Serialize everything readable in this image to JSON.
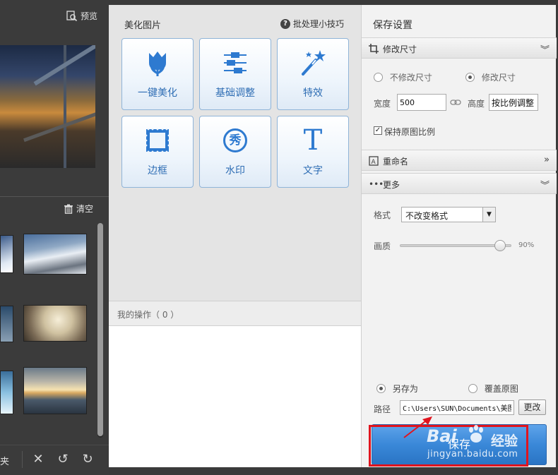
{
  "left_panel": {
    "preview_label": "预览",
    "clear_label": "清空",
    "folder_label": "夹"
  },
  "middle_panel": {
    "title": "美化图片",
    "tips_link": "批处理小技巧",
    "tiles": [
      {
        "label": "一键美化",
        "icon": "tulip-icon"
      },
      {
        "label": "基础调整",
        "icon": "sliders-icon"
      },
      {
        "label": "特效",
        "icon": "magic-wand-icon"
      },
      {
        "label": "边框",
        "icon": "frame-icon"
      },
      {
        "label": "水印",
        "icon": "watermark-icon"
      },
      {
        "label": "文字",
        "icon": "text-icon"
      }
    ],
    "watermark_glyph": "秀",
    "text_glyph": "T",
    "my_operations": "我的操作（ 0 ）"
  },
  "right_panel": {
    "title": "保存设置",
    "resize_section": "修改尺寸",
    "no_resize_option": "不修改尺寸",
    "resize_option": "修改尺寸",
    "resize_selected": "修改尺寸",
    "width_label": "宽度",
    "width_value": "500",
    "height_label": "高度",
    "height_value": "按比例调整",
    "keep_ratio_label": "保持原图比例",
    "keep_ratio_checked": true,
    "rename_section": "重命名",
    "more_section": "更多",
    "format_label": "格式",
    "format_value": "不改变格式",
    "quality_label": "画质",
    "quality_value": "90%",
    "quality_fraction": 0.9,
    "save_as_option": "另存为",
    "overwrite_option": "覆盖原图",
    "save_mode_selected": "另存为",
    "path_label": "路径",
    "path_value": "C:\\Users\\SUN\\Documents\\美图",
    "change_button": "更改",
    "save_button": "保存"
  },
  "watermark": {
    "brand": "Bai",
    "brand_suffix": "经验",
    "url": "jingyan.baidu.com"
  },
  "colors": {
    "accent_blue": "#2e6db4",
    "save_button_blue": "#3a88d8",
    "highlight_red": "#e0141e"
  }
}
